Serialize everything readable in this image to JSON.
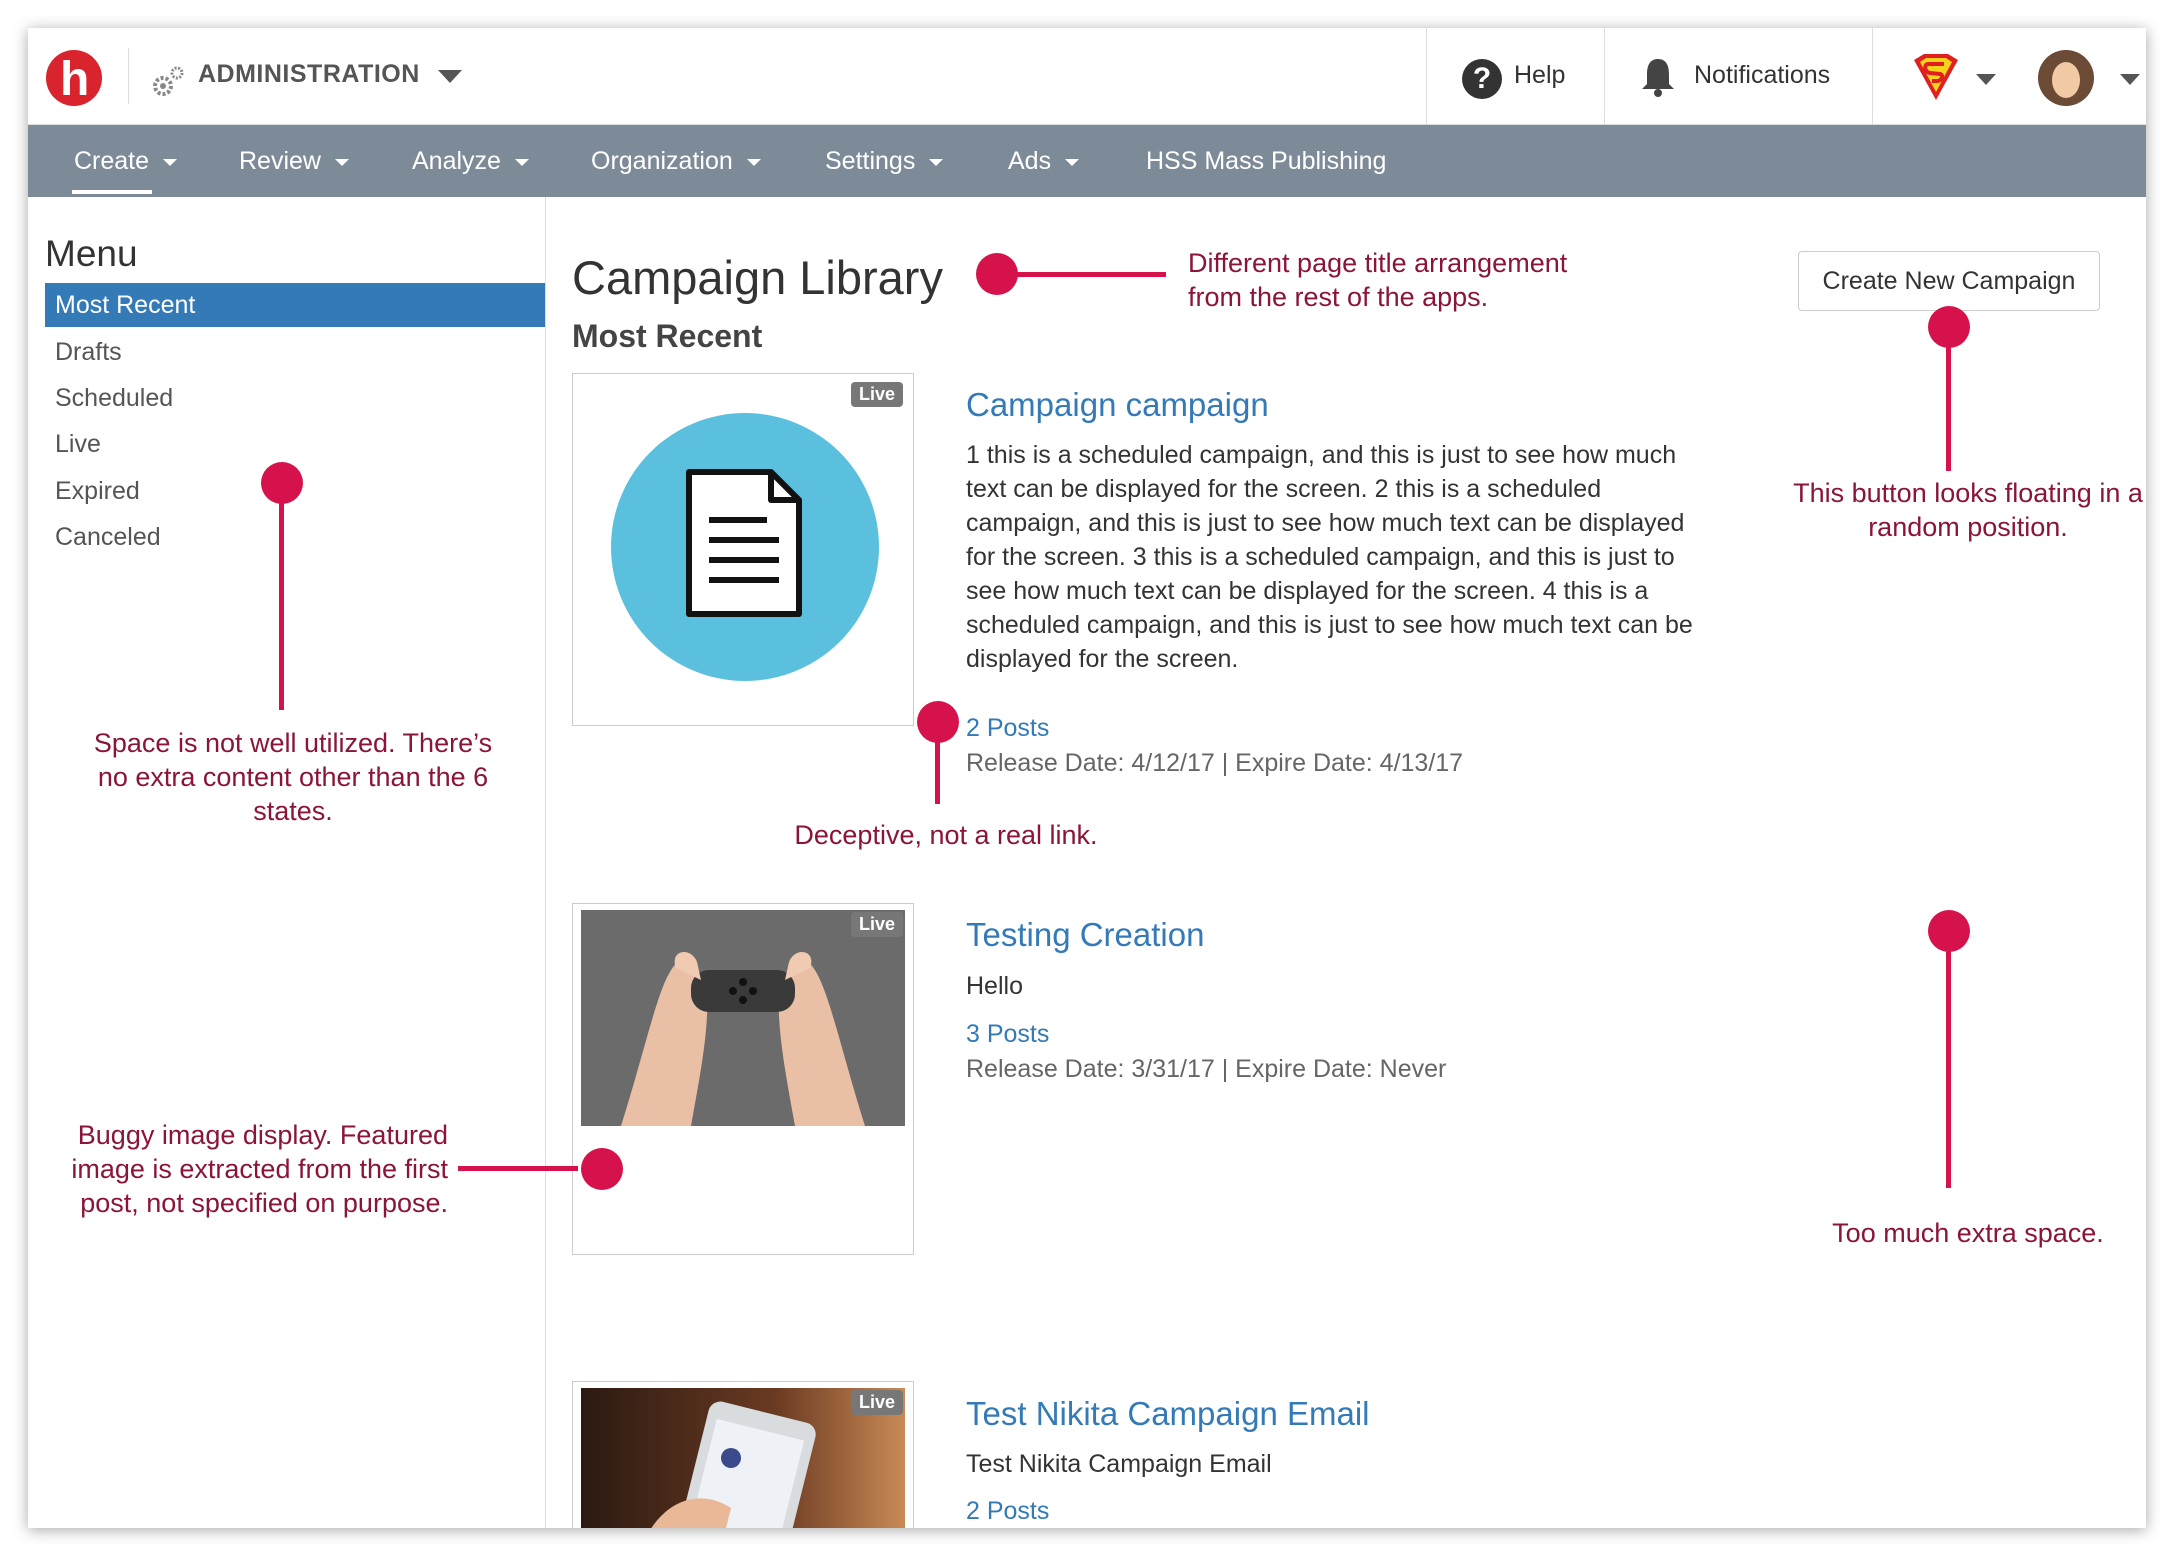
{
  "header": {
    "logo_letter": "h",
    "section": "ADMINISTRATION",
    "help": "Help",
    "notifications": "Notifications"
  },
  "nav": {
    "items": [
      {
        "label": "Create"
      },
      {
        "label": "Review"
      },
      {
        "label": "Analyze"
      },
      {
        "label": "Organization"
      },
      {
        "label": "Settings"
      },
      {
        "label": "Ads"
      },
      {
        "label": "HSS Mass Publishing"
      }
    ],
    "active": "Create"
  },
  "sidebar": {
    "title": "Menu",
    "items": [
      {
        "label": "Most Recent"
      },
      {
        "label": "Drafts"
      },
      {
        "label": "Scheduled"
      },
      {
        "label": "Live"
      },
      {
        "label": "Expired"
      },
      {
        "label": "Canceled"
      }
    ],
    "active": "Most Recent"
  },
  "main": {
    "title": "Campaign Library",
    "subtitle": "Most Recent",
    "create_button": "Create New Campaign",
    "campaigns": [
      {
        "badge": "Live",
        "title": "Campaign campaign",
        "description": "1 this is a scheduled campaign, and this is just to see how much text can be displayed for the screen. 2 this is a scheduled campaign, and this is just to see how much text can be displayed for the screen. 3 this is a scheduled campaign, and this is just to see how much text can be displayed for the screen. 4 this is a scheduled campaign, and this is just to see how much text can be displayed for the screen.",
        "posts": "2 Posts",
        "dates": "Release Date: 4/12/17 | Expire Date: 4/13/17"
      },
      {
        "badge": "Live",
        "title": "Testing Creation",
        "description": "Hello",
        "posts": "3 Posts",
        "dates": "Release Date: 3/31/17 | Expire Date: Never"
      },
      {
        "badge": "Live",
        "title": "Test Nikita Campaign Email",
        "description": "Test Nikita Campaign Email",
        "posts": "2 Posts"
      }
    ]
  },
  "annotations": {
    "title": "Different page title arrangement from the rest of the apps.",
    "button": "This button looks floating in a random position.",
    "space": "Space is not well utilized. There’s no extra content other than the 6 states.",
    "link": "Deceptive, not a real link.",
    "image": "Buggy image display. Featured image is extracted from the first post, not specified on purpose.",
    "extra": "Too much extra space."
  },
  "colors": {
    "brand": "#d9232d",
    "nav_bg": "#7d8b99",
    "link": "#337ab7",
    "annotation": "#d6124c",
    "annotation_text": "#8a1538"
  }
}
